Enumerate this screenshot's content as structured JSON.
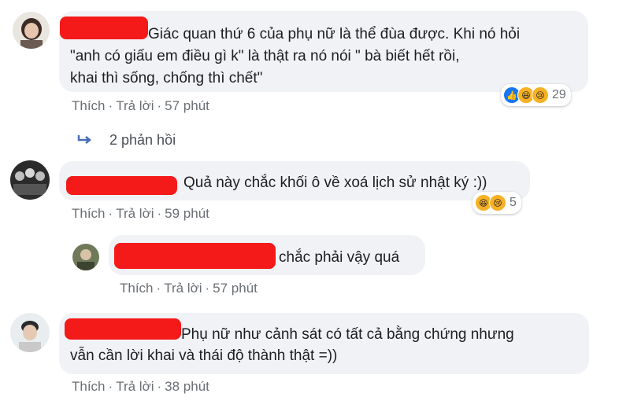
{
  "comments": [
    {
      "text_lines": [
        "Giác quan thứ 6 của phụ nữ là     thể đùa được. Khi nó hỏi",
        "\"anh có giấu em điều gì k\" là thật ra nó nói \"       bà      biết hết rồi,",
        "khai thì sống, chống thì chết\""
      ],
      "actions": {
        "like": "Thích",
        "reply": "Trả lời",
        "time": "57 phút"
      },
      "reaction_count": "29"
    },
    {
      "text_lines": [
        "Quả này chắc khối ô về xoá lịch sử nhật ký :))"
      ],
      "actions": {
        "like": "Thích",
        "reply": "Trả lời",
        "time": "59 phút"
      },
      "reaction_count": "5"
    },
    {
      "text_lines": [
        "chắc phải vậy quá"
      ],
      "actions": {
        "like": "Thích",
        "reply": "Trả lời",
        "time": "57 phút"
      }
    },
    {
      "text_lines": [
        "Phụ nữ như cảnh sát có tất cả bằng chứng nhưng",
        "vẫn cần lời khai và thái độ thành thật =))"
      ],
      "actions": {
        "like": "Thích",
        "reply": "Trả lời",
        "time": "38 phút"
      }
    }
  ],
  "replies_link": "2 phản hồi",
  "colors": {
    "bubble": "#f0f2f5",
    "redaction": "#f41a1a",
    "meta": "#6a6f75",
    "like": "#1877f2",
    "haha": "#f7b125"
  },
  "icons": {
    "like": "thumbs-up-icon",
    "haha": "laughing-face-icon",
    "sad": "sad-face-icon",
    "reply_arrow": "reply-arrow-icon"
  }
}
